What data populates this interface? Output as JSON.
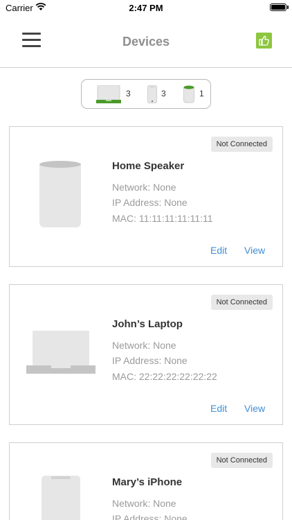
{
  "status_bar": {
    "carrier": "Carrier",
    "time": "2:47 PM"
  },
  "nav": {
    "title": "Devices",
    "menu_icon": "hamburger-menu-icon",
    "feedback_icon": "thumbs-up-icon",
    "accent_color": "#8dc63f"
  },
  "filters": [
    {
      "icon": "laptop-icon",
      "count": "3"
    },
    {
      "icon": "phone-icon",
      "count": "3"
    },
    {
      "icon": "speaker-icon",
      "count": "1"
    }
  ],
  "devices": [
    {
      "name": "Home Speaker",
      "status": "Not Connected",
      "network": "Network: None",
      "ip": "IP Address: None",
      "mac": "MAC: 11:11:11:11:11:11",
      "edit_label": "Edit",
      "view_label": "View",
      "icon": "speaker-icon"
    },
    {
      "name": "John’s Laptop",
      "status": "Not Connected",
      "network": "Network: None",
      "ip": "IP Address: None",
      "mac": "MAC: 22:22:22:22:22:22",
      "edit_label": "Edit",
      "view_label": "View",
      "icon": "laptop-icon"
    },
    {
      "name": "Mary’s iPhone",
      "status": "Not Connected",
      "network": "Network: None",
      "ip": "IP Address: None",
      "mac": "",
      "edit_label": "",
      "view_label": "",
      "icon": "phone-icon"
    }
  ],
  "colors": {
    "link": "#3d8fd6",
    "muted_text": "#9a9a9a",
    "badge_bg": "#e8e8e8"
  }
}
